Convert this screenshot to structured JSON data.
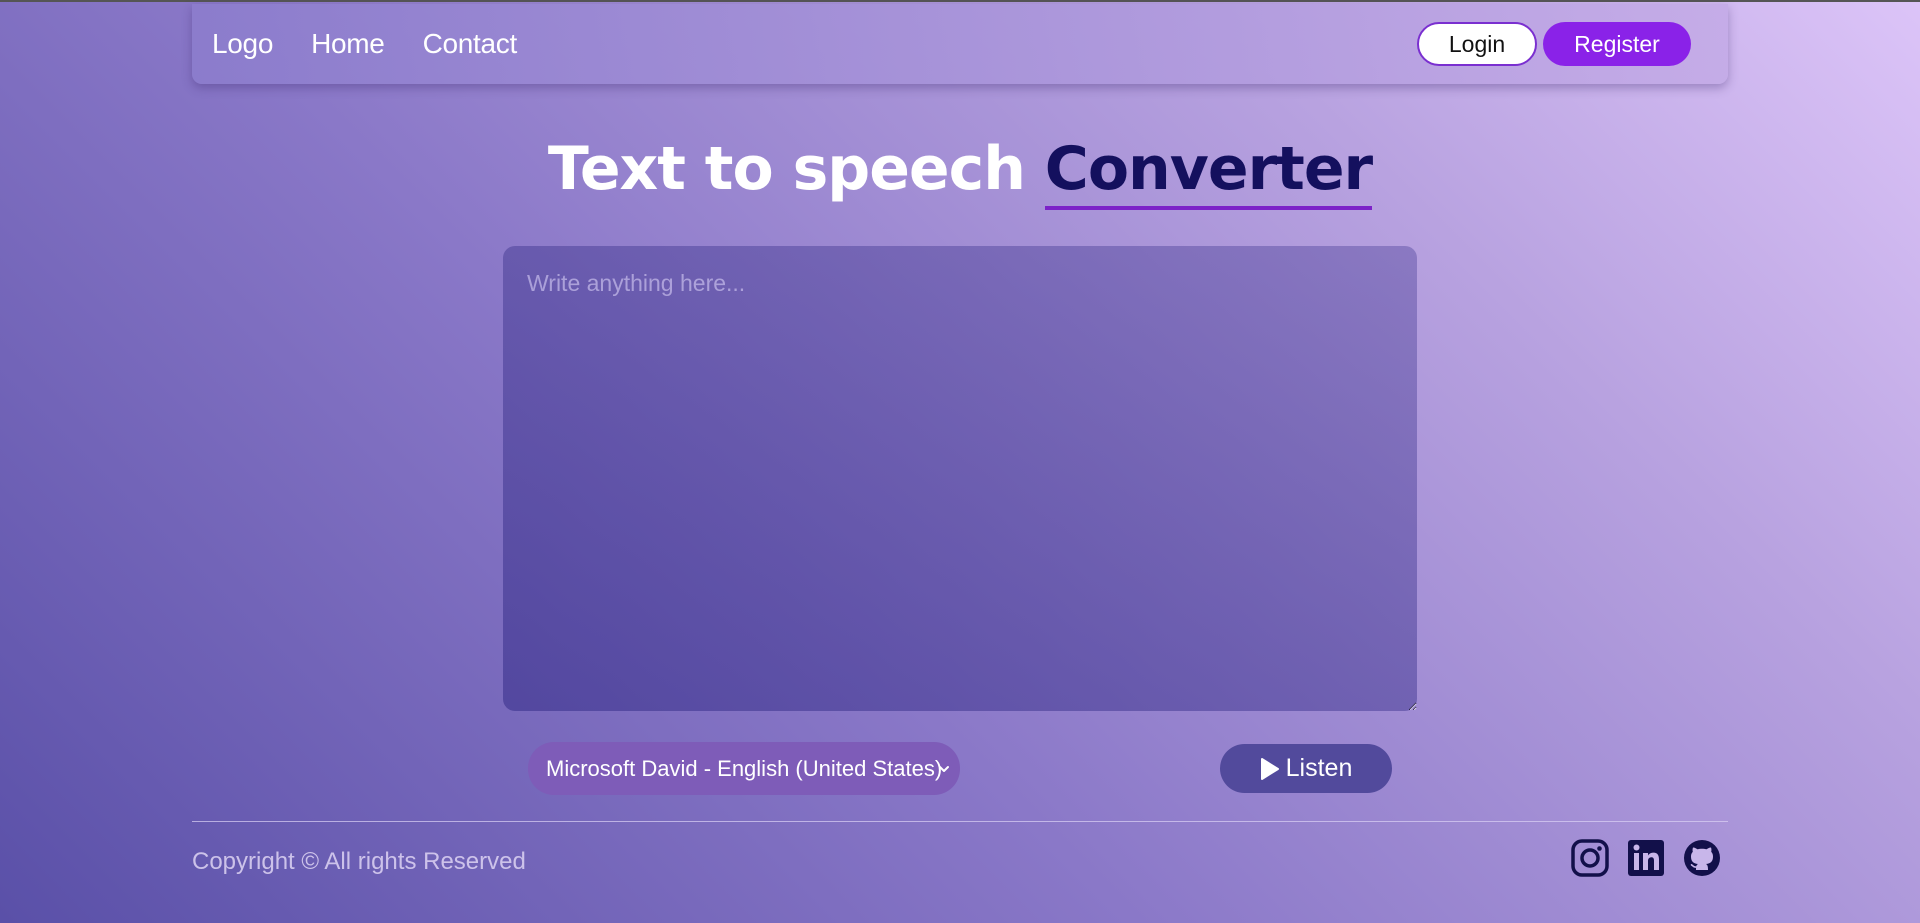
{
  "nav": {
    "logo": "Logo",
    "home": "Home",
    "contact": "Contact",
    "login": "Login",
    "register": "Register"
  },
  "title": {
    "main": "Text to speech",
    "accent": "Converter"
  },
  "textarea": {
    "placeholder": "Write anything here...",
    "value": ""
  },
  "voice_select": {
    "selected": "Microsoft David - English (United States)"
  },
  "listen_button": {
    "label": "Listen",
    "icon": "play-icon"
  },
  "footer": {
    "copyright": "Copyright © All rights Reserved",
    "socials": [
      "instagram-icon",
      "linkedin-icon",
      "github-icon"
    ]
  },
  "colors": {
    "accent_purple": "#8a22e8",
    "title_accent": "#14105e",
    "underline": "#7c22c8",
    "listen_bg": "#524a9c",
    "select_bg": "#7e5cb8"
  }
}
